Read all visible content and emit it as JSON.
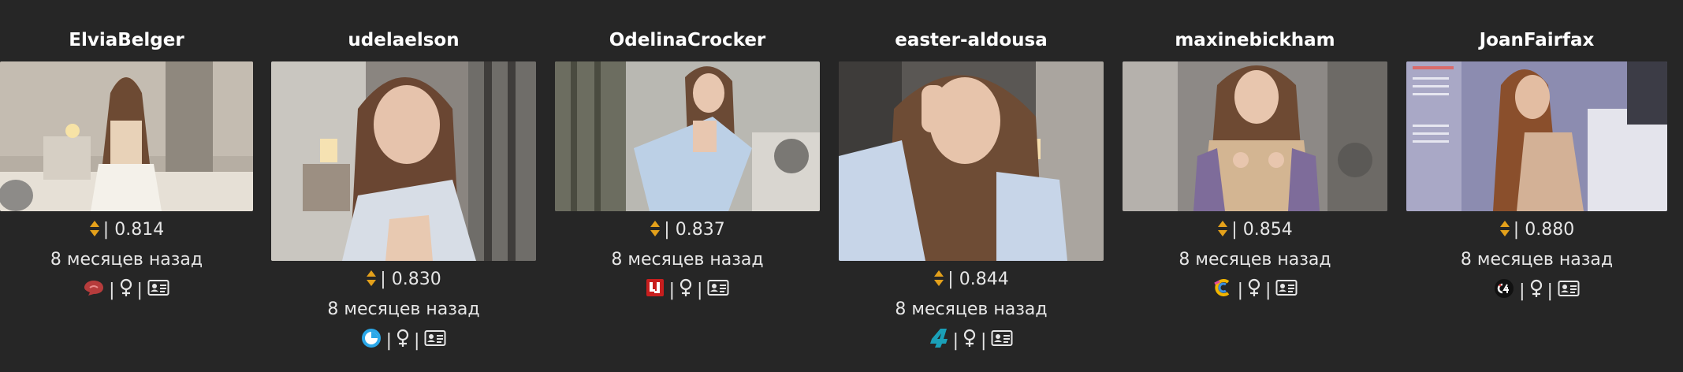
{
  "cards": [
    {
      "username": "ElviaBelger",
      "score": "0.814",
      "time_ago": "8 месяцев назад",
      "platform_icon": "chat-bubble-red-icon",
      "thumb_colors": [
        "#b9b2a8",
        "#8d8478",
        "#e8e2d8"
      ]
    },
    {
      "username": "udelaelson",
      "score": "0.830",
      "time_ago": "8 месяцев назад",
      "platform_icon": "circle-blue-icon",
      "thumb_colors": [
        "#5b5550",
        "#a98c78",
        "#d7dde6"
      ]
    },
    {
      "username": "OdelinaCrocker",
      "score": "0.837",
      "time_ago": "8 месяцев назад",
      "platform_icon": "red-square-logo-icon",
      "thumb_colors": [
        "#6e7062",
        "#c5c7c2",
        "#b7cbe0"
      ]
    },
    {
      "username": "easter-aldousa",
      "score": "0.844",
      "time_ago": "8 месяцев назад",
      "platform_icon": "teal-4-logo-icon",
      "thumb_colors": [
        "#4f4b47",
        "#7a5a44",
        "#c9d6e8"
      ]
    },
    {
      "username": "maxinebickham",
      "score": "0.854",
      "time_ago": "8 месяцев назад",
      "platform_icon": "rainbow-c-logo-icon",
      "thumb_colors": [
        "#8e8a86",
        "#d1b592",
        "#7e6c9a"
      ]
    },
    {
      "username": "JoanFairfax",
      "score": "0.880",
      "time_ago": "8 месяцев назад",
      "platform_icon": "c4-black-logo-icon",
      "thumb_colors": [
        "#8a8bb0",
        "#d3b196",
        "#e3e2ec"
      ]
    }
  ],
  "colors": {
    "background": "#262626",
    "sort_icon": "#e4a11b",
    "text": "#e6e6e6"
  }
}
